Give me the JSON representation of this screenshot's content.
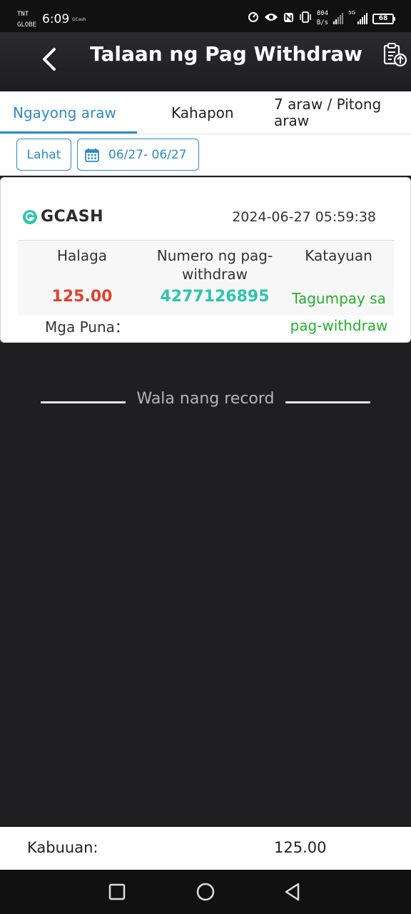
{
  "status_bar": {
    "carrier_line1": "TNT",
    "carrier_line2": "GLOBE",
    "time": "6:09",
    "notification_app": "GCash",
    "net_speed_value": "804",
    "net_speed_unit": "B/s",
    "network_type": "5G",
    "battery_level": "68"
  },
  "header": {
    "title": "Talaan ng Pag Withdraw",
    "back_icon": "chevron-left-icon",
    "action_icon": "clipboard-upload-icon"
  },
  "tabs": [
    {
      "label": "Ngayong araw",
      "active": true
    },
    {
      "label": "Kahapon",
      "active": false
    },
    {
      "label": "7 araw / Pitong araw",
      "active": false
    }
  ],
  "filters": {
    "all_label": "Lahat",
    "date_range": "06/27- 06/27",
    "date_icon": "calendar-icon"
  },
  "record": {
    "channel": "GCASH",
    "datetime": "2024-06-27 05:59:38",
    "amount_header": "Halaga",
    "number_header": "Numero ng pag-withdraw",
    "status_header": "Katayuan",
    "amount": "125.00",
    "withdraw_number": "4277126895",
    "status": "Tagumpay sa pag-withdraw",
    "remarks_label": "Mga Puna："
  },
  "list_end": {
    "message": "Wala nang record"
  },
  "footer": {
    "total_label": "Kabuuan:",
    "total_value": "125.00"
  },
  "colors": {
    "accent": "#2c8bc9",
    "amount": "#e0402b",
    "withdraw_number": "#2ec4ac",
    "status_success": "#22b12a",
    "background": "#1f1f21"
  }
}
